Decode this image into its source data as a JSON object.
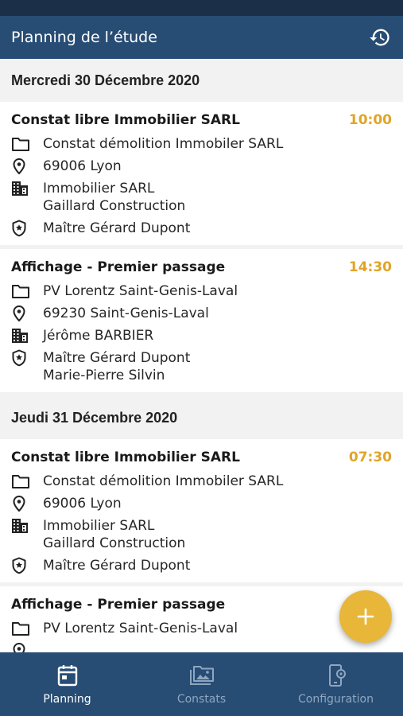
{
  "header": {
    "title": "Planning de l’étude"
  },
  "days": [
    {
      "label": "Mercredi 30 Décembre 2020",
      "events": [
        {
          "title": "Constat libre Immobilier SARL",
          "time": "10:00",
          "folder": "Constat démolition Immobiler SARL",
          "location": "69006 Lyon",
          "company": [
            "Immobilier SARL",
            "Gaillard Construction"
          ],
          "bailiff": [
            "Maître Gérard Dupont"
          ]
        },
        {
          "title": "Affichage - Premier passage",
          "time": "14:30",
          "folder": "PV Lorentz Saint-Genis-Laval",
          "location": "69230 Saint-Genis-Laval",
          "company": [
            "Jérôme BARBIER"
          ],
          "bailiff": [
            "Maître Gérard Dupont",
            "Marie-Pierre Silvin"
          ]
        }
      ]
    },
    {
      "label": "Jeudi 31 Décembre 2020",
      "events": [
        {
          "title": "Constat libre Immobilier SARL",
          "time": "07:30",
          "folder": "Constat démolition Immobiler SARL",
          "location": "69006 Lyon",
          "company": [
            "Immobilier SARL",
            "Gaillard Construction"
          ],
          "bailiff": [
            "Maître Gérard Dupont"
          ]
        },
        {
          "title": "Affichage - Premier passage",
          "time": "",
          "folder": "PV Lorentz Saint-Genis-Laval"
        }
      ]
    }
  ],
  "fab": {
    "label": "+"
  },
  "nav": {
    "planning": "Planning",
    "constats": "Constats",
    "configuration": "Configuration"
  },
  "colors": {
    "primary": "#284d74",
    "status_bar": "#1b2f49",
    "accent": "#e8b73a",
    "time": "#e0a526",
    "nav_inactive": "#8fa6c0"
  }
}
